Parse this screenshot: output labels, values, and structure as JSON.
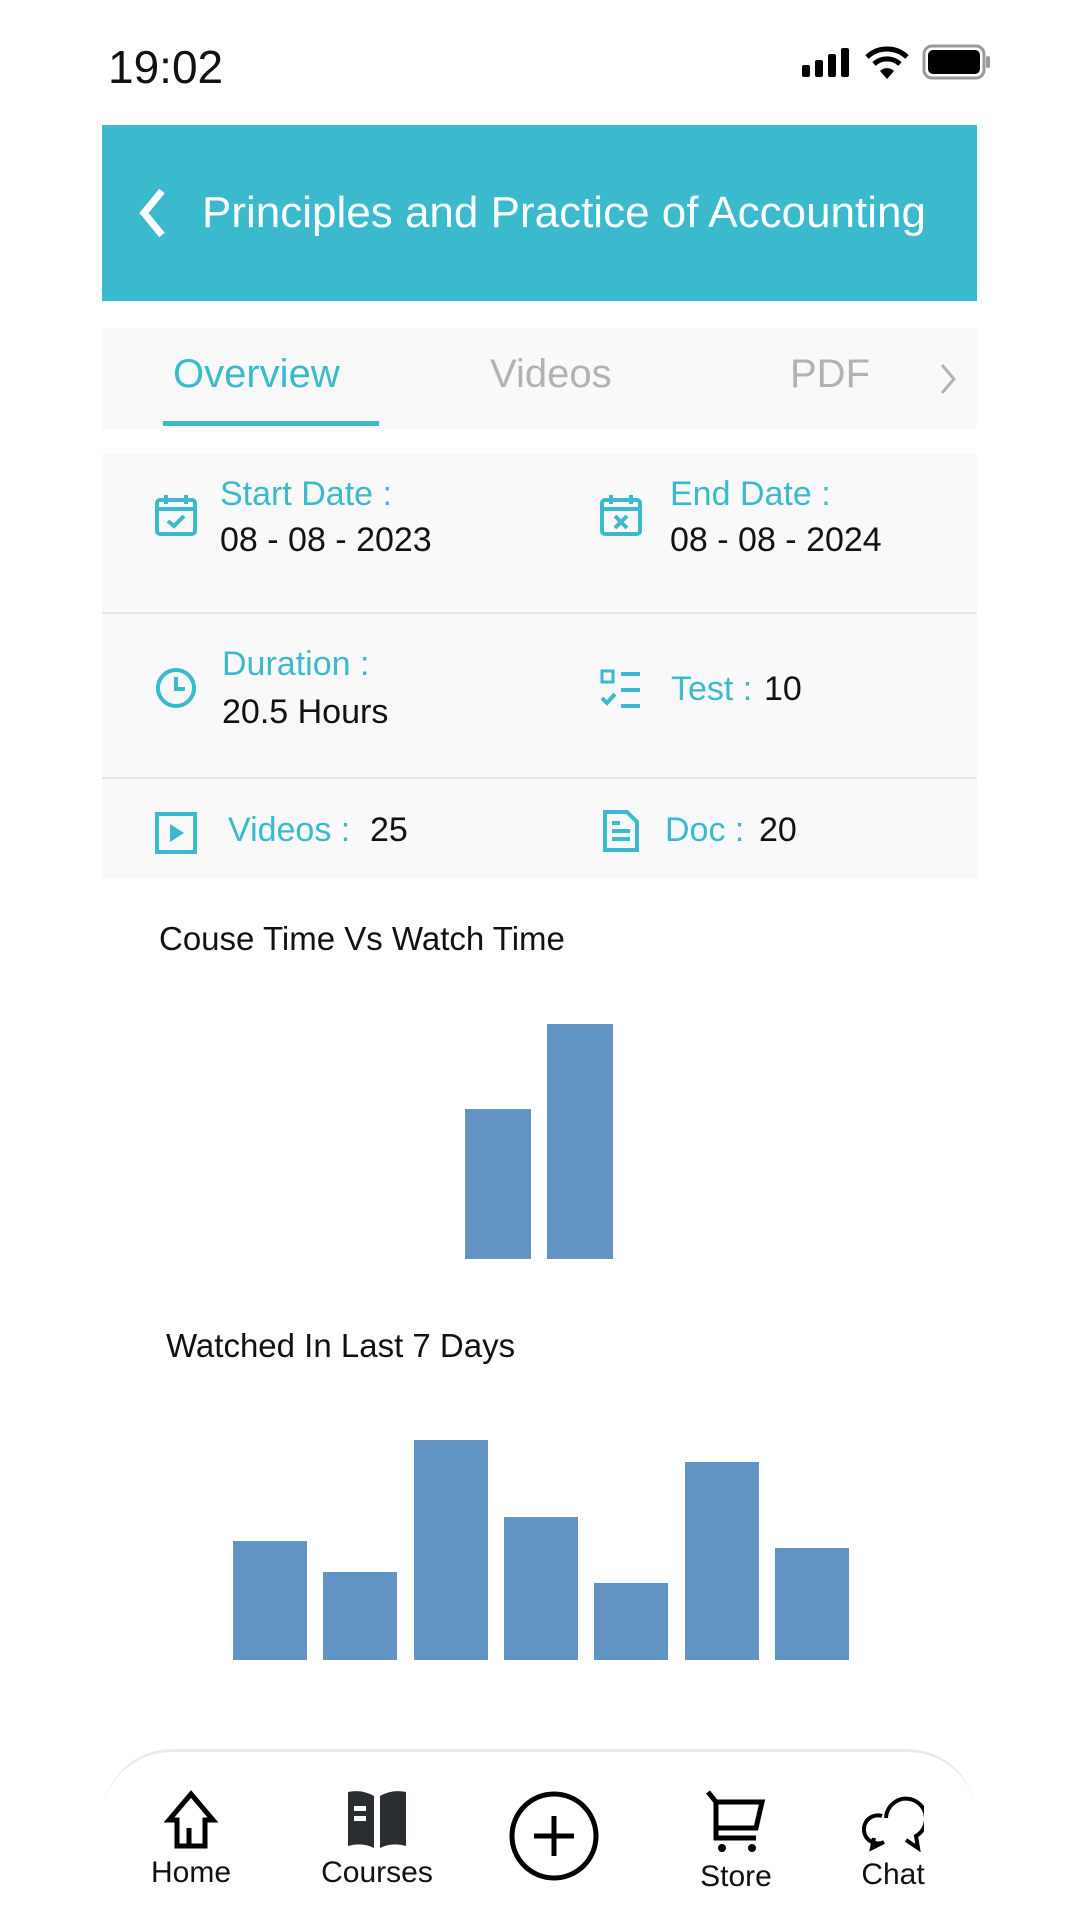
{
  "status_bar": {
    "time": "19:02",
    "icons": [
      "signal-icon",
      "wifi-icon",
      "battery-icon"
    ]
  },
  "header": {
    "title": "Principles and Practice of Accounting",
    "back_icon": "chevron-left-icon",
    "color": "#3bbacd"
  },
  "tabs": [
    {
      "label": "Overview",
      "active": true
    },
    {
      "label": "Videos",
      "active": false
    },
    {
      "label": "PDF",
      "active": false
    }
  ],
  "info": {
    "start_date": {
      "label": "Start Date :",
      "value": "08 - 08 - 2023"
    },
    "end_date": {
      "label": "End Date :",
      "value": "08 - 08 - 2024"
    },
    "duration": {
      "label": "Duration :",
      "value": "20.5 Hours"
    },
    "test": {
      "label": "Test :",
      "value": "10"
    },
    "videos": {
      "label": "Videos :",
      "value": "25"
    },
    "doc": {
      "label": "Doc :",
      "value": "20"
    }
  },
  "chart_data": [
    {
      "type": "bar",
      "title": "Couse Time Vs Watch Time",
      "values": [
        64,
        100
      ],
      "color": "#6193c3"
    },
    {
      "type": "bar",
      "title": "Watched In Last 7 Days",
      "values": [
        54,
        40,
        100,
        65,
        35,
        90,
        51
      ],
      "color": "#6193c3"
    }
  ],
  "nav": [
    {
      "label": "Home",
      "icon": "home-icon"
    },
    {
      "label": "Courses",
      "icon": "book-icon"
    },
    {
      "label": "",
      "icon": "plus-circle-icon"
    },
    {
      "label": "Store",
      "icon": "cart-icon"
    },
    {
      "label": "Chat",
      "icon": "chat-icon"
    }
  ]
}
